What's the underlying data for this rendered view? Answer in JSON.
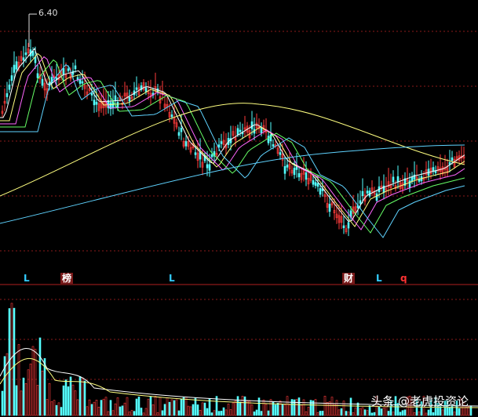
{
  "peak_label": "6.40",
  "markers": [
    {
      "text": "L",
      "color": "#33ccff",
      "bg": ""
    },
    {
      "text": "榜",
      "color": "#ffffff",
      "bg": "#7a1a1a"
    },
    {
      "text": "L",
      "color": "#33ccff",
      "bg": ""
    },
    {
      "text": "财",
      "color": "#ffffff",
      "bg": "#7a1a1a"
    },
    {
      "text": "L",
      "color": "#33ccff",
      "bg": ""
    },
    {
      "text": "q",
      "color": "#ff3333",
      "bg": ""
    }
  ],
  "watermark": "头条 @老虎投资论",
  "colors": {
    "background": "#000000",
    "up": "#ff3b3b",
    "down": "#54ffff",
    "grid": "#8b1a1a",
    "ma_yellow": "#ffff80",
    "ma_cyan": "#5fd3ff",
    "ma_magenta": "#ff66ff",
    "ma_green": "#66ff66",
    "ma_white": "#ffffff"
  }
}
